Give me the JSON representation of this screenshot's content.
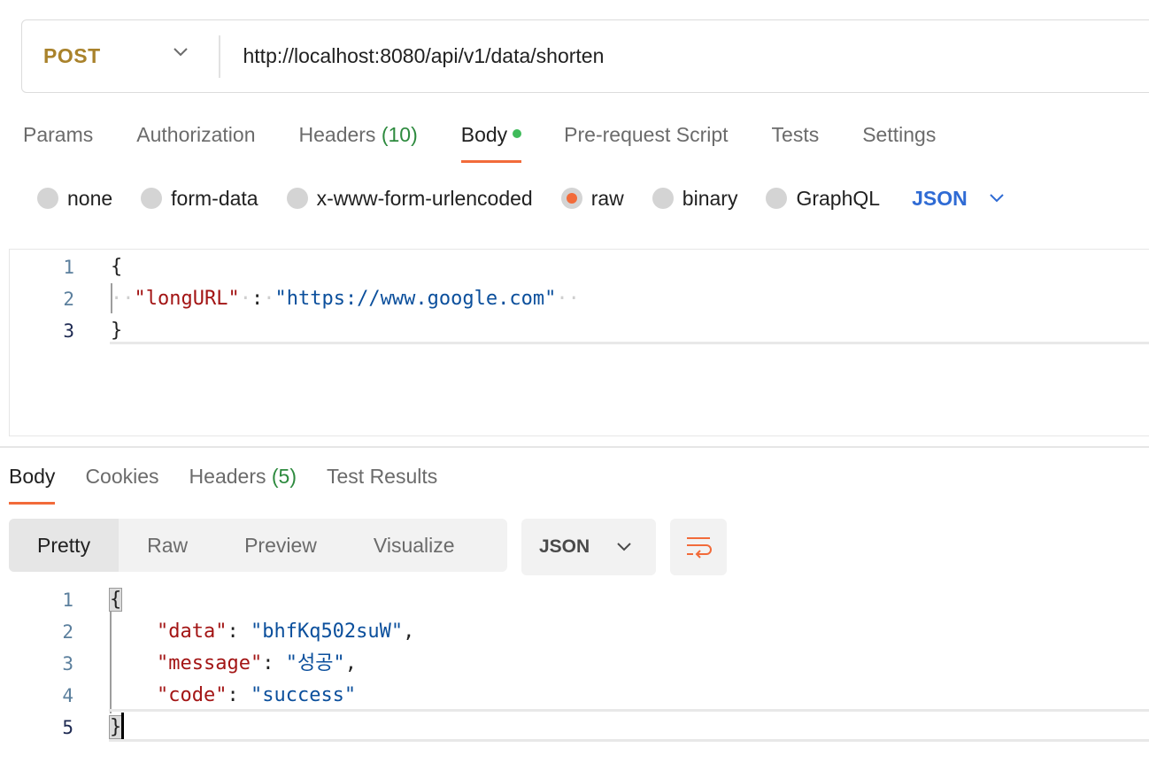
{
  "request": {
    "method": "POST",
    "url": "http://localhost:8080/api/v1/data/shorten"
  },
  "request_tabs": [
    {
      "label": "Params"
    },
    {
      "label": "Authorization"
    },
    {
      "label": "Headers",
      "count": "(10)"
    },
    {
      "label": "Body",
      "active": true
    },
    {
      "label": "Pre-request Script"
    },
    {
      "label": "Tests"
    },
    {
      "label": "Settings"
    }
  ],
  "body_types": [
    "none",
    "form-data",
    "x-www-form-urlencoded",
    "raw",
    "binary",
    "GraphQL"
  ],
  "body_type_selected": "raw",
  "body_language": "JSON",
  "request_body": {
    "line_numbers": [
      "1",
      "2",
      "3"
    ],
    "open": "{",
    "key": "\"longURL\"",
    "colon": ":",
    "value": "\"https://www.google.com\"",
    "close": "}"
  },
  "response_tabs": [
    {
      "label": "Body",
      "active": true
    },
    {
      "label": "Cookies"
    },
    {
      "label": "Headers",
      "count": "(5)"
    },
    {
      "label": "Test Results"
    }
  ],
  "view_modes": [
    "Pretty",
    "Raw",
    "Preview",
    "Visualize"
  ],
  "view_mode_selected": "Pretty",
  "response_format": "JSON",
  "response_body": {
    "line_numbers": [
      "1",
      "2",
      "3",
      "4",
      "5"
    ],
    "open": "{",
    "lines": [
      {
        "key": "\"data\"",
        "value": "\"bhfKq502suW\"",
        "trail": ","
      },
      {
        "key": "\"message\"",
        "value": "\"성공\"",
        "trail": ","
      },
      {
        "key": "\"code\"",
        "value": "\"success\"",
        "trail": ""
      }
    ],
    "close": "}"
  },
  "colors": {
    "accent": "#f26b3a",
    "method": "#a9822b",
    "language": "#2f6bd4",
    "count": "#2d8a3e",
    "json_key": "#a31515",
    "json_string": "#0b4f9c"
  }
}
